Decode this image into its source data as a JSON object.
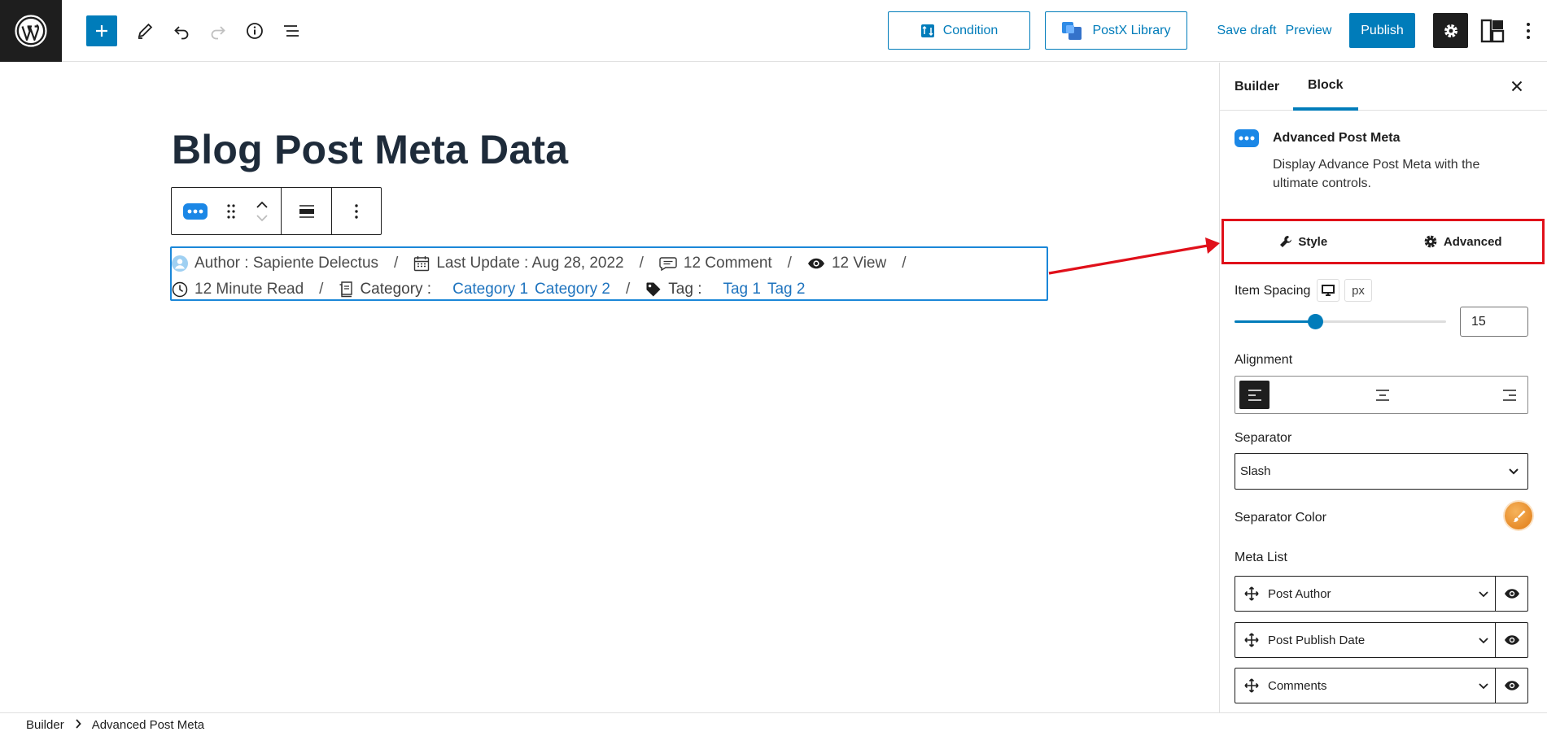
{
  "toolbar": {
    "condition_label": "Condition",
    "library_label": "PostX Library",
    "save_draft_label": "Save draft",
    "preview_label": "Preview",
    "publish_label": "Publish"
  },
  "editor": {
    "post_title": "Blog Post Meta Data",
    "meta": {
      "author": "Author : Sapiente Delectus",
      "last_update": "Last Update : Aug 28, 2022",
      "comments": "12 Comment",
      "views": "12 View",
      "read_time": "12 Minute Read",
      "category_label": "Category :",
      "categories": [
        "Category 1",
        "Category 2"
      ],
      "tag_label": "Tag :",
      "tags": [
        "Tag 1",
        "Tag 2"
      ],
      "separator": "/"
    }
  },
  "sidebar": {
    "tabs": [
      "Builder",
      "Block"
    ],
    "active_tab": "Block",
    "block_name": "Advanced Post Meta",
    "block_description": "Display Advance Post Meta with the ultimate controls.",
    "style_tab": "Style",
    "advanced_tab": "Advanced",
    "item_spacing_label": "Item Spacing",
    "item_spacing_unit": "px",
    "item_spacing_value": "15",
    "item_spacing_fraction": 0.38,
    "alignment_label": "Alignment",
    "alignment_selected": "left",
    "separator_label": "Separator",
    "separator_value": "Slash",
    "separator_color_label": "Separator Color",
    "meta_list_label": "Meta List",
    "meta_list": [
      "Post Author",
      "Post Publish Date",
      "Comments"
    ]
  },
  "footer": {
    "crumbs": [
      "Builder",
      "Advanced Post Meta"
    ]
  },
  "colors": {
    "accent": "#007cba",
    "link": "#1e73be",
    "annotation": "#e0101a",
    "dark": "#1e1e1e"
  }
}
